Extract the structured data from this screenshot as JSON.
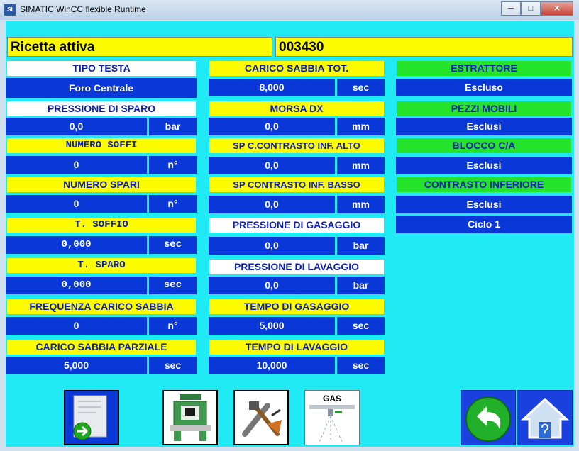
{
  "window": {
    "title": "SIMATIC WinCC flexible Runtime",
    "icon_label": "SI",
    "minimize_icon": "minimize-icon",
    "maximize_icon": "maximize-icon",
    "close_icon": "close-icon"
  },
  "recipe": {
    "label": "Ricetta attiva",
    "value": "003430"
  },
  "left": {
    "tipo_testa": "TIPO TESTA",
    "tipo_testa_value": "Foro Centrale",
    "pressione_sparo": "PRESSIONE DI SPARO",
    "pressione_sparo_value": "0,0",
    "pressione_sparo_unit": "bar",
    "numero_soffi": "NUMERO SOFFI",
    "numero_soffi_value": "0",
    "numero_soffi_unit": "n°",
    "numero_spari": "NUMERO SPARI",
    "numero_spari_value": "0",
    "numero_spari_unit": "n°",
    "t_soffio": "T. SOFFIO",
    "t_soffio_value": "0,000",
    "t_soffio_unit": "sec",
    "t_sparo": "T. SPARO",
    "t_sparo_value": "0,000",
    "t_sparo_unit": "sec",
    "freq_carico": "FREQUENZA CARICO SABBIA",
    "freq_carico_value": "0",
    "freq_carico_unit": "n°",
    "carico_parziale": "CARICO SABBIA PARZIALE",
    "carico_parziale_value": "5,000",
    "carico_parziale_unit": "sec"
  },
  "middle": {
    "carico_tot": "CARICO SABBIA TOT.",
    "carico_tot_value": "8,000",
    "carico_tot_unit": "sec",
    "morsa_dx": "MORSA DX",
    "morsa_dx_value": "0,0",
    "morsa_dx_unit": "mm",
    "sp_alto": "SP C.CONTRASTO INF. ALTO",
    "sp_alto_value": "0,0",
    "sp_alto_unit": "mm",
    "sp_basso": "SP CONTRASTO INF. BASSO",
    "sp_basso_value": "0,0",
    "sp_basso_unit": "mm",
    "pressione_gasaggio": "PRESSIONE DI GASAGGIO",
    "pressione_gasaggio_value": "0,0",
    "pressione_gasaggio_unit": "bar",
    "pressione_lavaggio": "PRESSIONE DI LAVAGGIO",
    "pressione_lavaggio_value": "0,0",
    "pressione_lavaggio_unit": "bar",
    "tempo_gasaggio": "TEMPO DI GASAGGIO",
    "tempo_gasaggio_value": "5,000",
    "tempo_gasaggio_unit": "sec",
    "tempo_lavaggio": "TEMPO DI LAVAGGIO",
    "tempo_lavaggio_value": "10,000",
    "tempo_lavaggio_unit": "sec"
  },
  "right": {
    "estrattore": "ESTRATTORE",
    "estrattore_value": "Escluso",
    "pezzi_mobili": "PEZZI MOBILI",
    "pezzi_mobili_value": "Esclusi",
    "blocco": "BLOCCO C/A",
    "blocco_value": "Esclusi",
    "contrasto": "CONTRASTO INFERIORE",
    "contrasto_value": "Esclusi",
    "ciclo": "Ciclo 1"
  },
  "buttons": {
    "gas_label": "GAS",
    "recipe_icon": "recipe-document-icon",
    "machine_icon": "machine-icon",
    "tools_icon": "tools-icon",
    "gas_icon": "gas-icon",
    "back_icon": "back-arrow-icon",
    "home_icon": "home-icon"
  },
  "colors": {
    "screen_bg": "#20ebf5",
    "header_yellow": "#fdfb00",
    "value_blue": "#0a38d8",
    "header_green": "#25e32a",
    "header_text": "#0a1fb0"
  }
}
